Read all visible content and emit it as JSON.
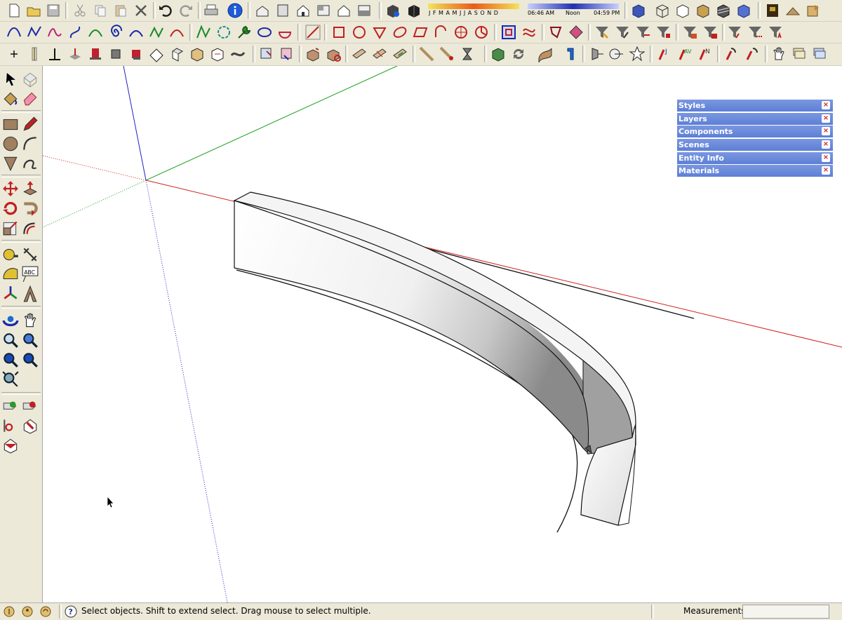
{
  "shadow_settings": {
    "months": "J F M A M J J A S O N D",
    "time_start": "06:46 AM",
    "time_noon": "Noon",
    "time_end": "04:59 PM"
  },
  "trays": [
    {
      "label": "Styles"
    },
    {
      "label": "Layers"
    },
    {
      "label": "Components"
    },
    {
      "label": "Scenes"
    },
    {
      "label": "Entity Info"
    },
    {
      "label": "Materials"
    }
  ],
  "tray_close_glyph": "×",
  "statusbar": {
    "text": "Select objects. Shift to extend select. Drag mouse to select multiple.",
    "measurements_label": "Measurements",
    "measurements_value": ""
  },
  "colors": {
    "red_axis": "#d02020",
    "green_axis": "#1fa01f",
    "blue_axis": "#2020c0",
    "tray_header": "#6787da"
  }
}
